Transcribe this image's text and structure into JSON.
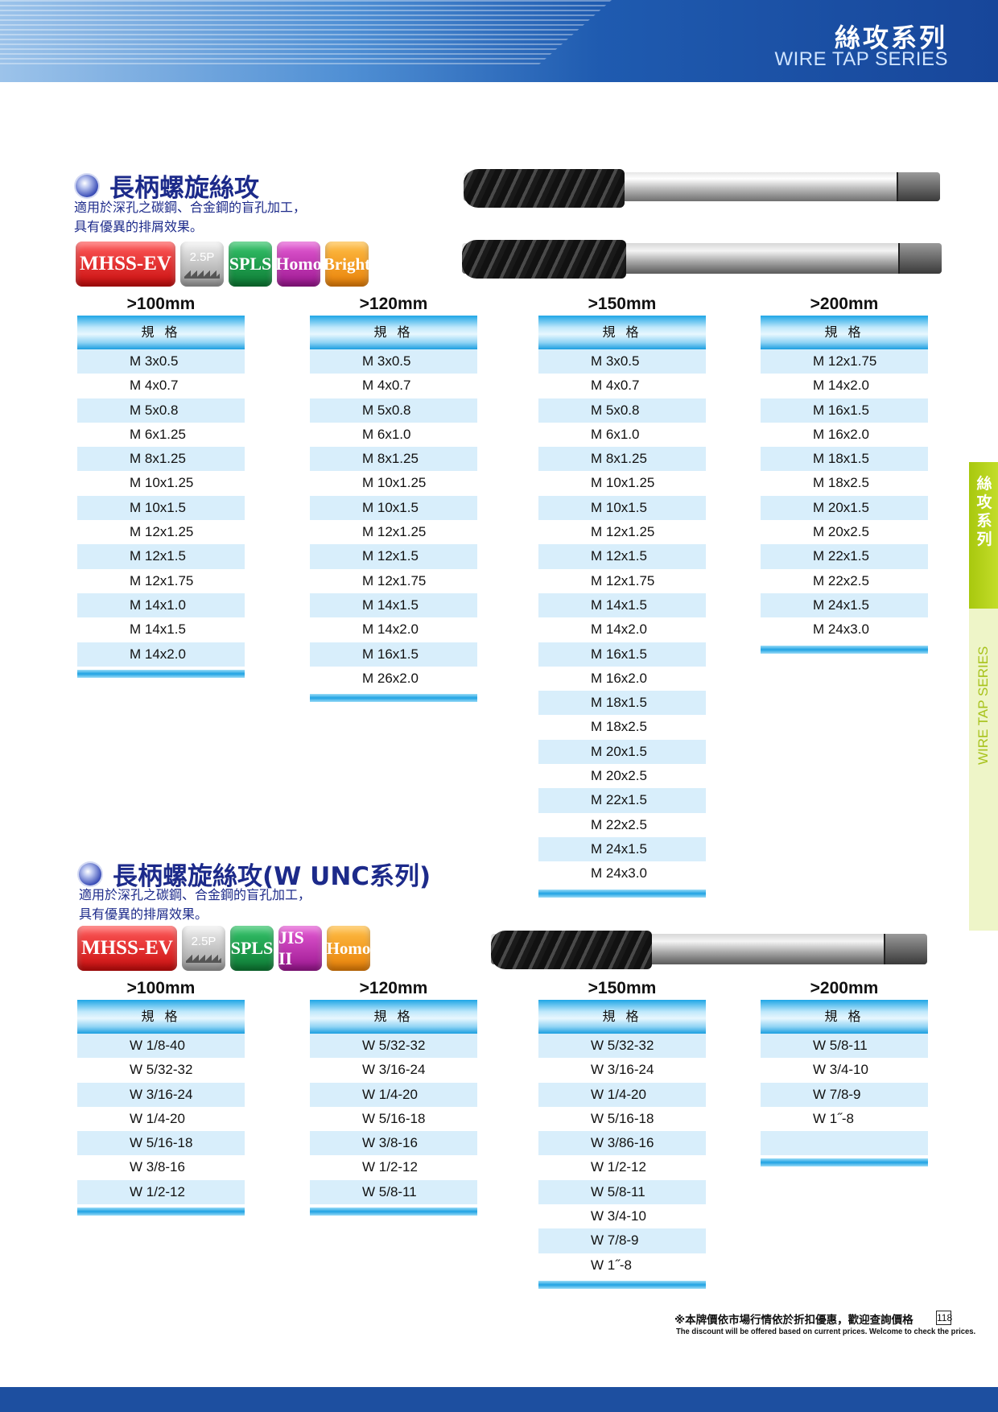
{
  "header": {
    "title_zh": "絲攻系列",
    "title_en": "WIRE TAP SERIES"
  },
  "side_tab": {
    "zh": "絲\n攻\n系\n列",
    "en": "WIRE TAP SERIES"
  },
  "section1": {
    "title": "長柄螺旋絲攻",
    "desc1": "適用於深孔之碳鋼、合金鋼的盲孔加工，",
    "desc2": "具有優異的排屑效果。",
    "badges": [
      "MHSS-EV",
      "2.5P",
      "SPLS",
      "Homo",
      "Bright"
    ],
    "columns": [
      {
        "head": ">100mm",
        "th": "規 格",
        "rows": [
          "M 3x0.5",
          "M 4x0.7",
          "M 5x0.8",
          "M 6x1.25",
          "M 8x1.25",
          "M 10x1.25",
          "M 10x1.5",
          "M 12x1.25",
          "M 12x1.5",
          "M 12x1.75",
          "M 14x1.0",
          "M 14x1.5",
          "M 14x2.0"
        ]
      },
      {
        "head": ">120mm",
        "th": "規 格",
        "rows": [
          "M 3x0.5",
          "M 4x0.7",
          "M 5x0.8",
          "M 6x1.0",
          "M 8x1.25",
          "M 10x1.25",
          "M 10x1.5",
          "M 12x1.25",
          "M 12x1.5",
          "M 12x1.75",
          "M 14x1.5",
          "M 14x2.0",
          "M 16x1.5",
          "M 26x2.0"
        ]
      },
      {
        "head": ">150mm",
        "th": "規 格",
        "rows": [
          "M 3x0.5",
          "M 4x0.7",
          "M 5x0.8",
          "M 6x1.0",
          "M 8x1.25",
          "M 10x1.25",
          "M 10x1.5",
          "M 12x1.25",
          "M 12x1.5",
          "M 12x1.75",
          "M 14x1.5",
          "M 14x2.0",
          "M 16x1.5",
          "M 16x2.0",
          "M 18x1.5",
          "M 18x2.5",
          "M 20x1.5",
          "M 20x2.5",
          "M 22x1.5",
          "M 22x2.5",
          "M 24x1.5",
          "M 24x3.0"
        ]
      },
      {
        "head": ">200mm",
        "th": "規 格",
        "rows": [
          "M 12x1.75",
          "M 14x2.0",
          "M 16x1.5",
          "M 16x2.0",
          "M 18x1.5",
          "M 18x2.5",
          "M 20x1.5",
          "M 20x2.5",
          "M 22x1.5",
          "M 22x2.5",
          "M 24x1.5",
          "M 24x3.0"
        ]
      }
    ]
  },
  "section2": {
    "title": "長柄螺旋絲攻(W UNC系列)",
    "desc1": "適用於深孔之碳鋼、合金鋼的盲孔加工，",
    "desc2": "具有優異的排屑效果。",
    "badges": [
      "MHSS-EV",
      "2.5P",
      "SPLS",
      "JIS II",
      "Homo"
    ],
    "columns": [
      {
        "head": ">100mm",
        "th": "規 格",
        "rows": [
          "W 1/8-40",
          "W 5/32-32",
          "W 3/16-24",
          "W 1/4-20",
          "W 5/16-18",
          "W 3/8-16",
          "W 1/2-12"
        ]
      },
      {
        "head": ">120mm",
        "th": "規 格",
        "rows": [
          "W 5/32-32",
          "W 3/16-24",
          "W 1/4-20",
          "W 5/16-18",
          "W 3/8-16",
          "W 1/2-12",
          "W 5/8-11"
        ]
      },
      {
        "head": ">150mm",
        "th": "規 格",
        "rows": [
          "W 5/32-32",
          "W 3/16-24",
          "W 1/4-20",
          "W 5/16-18",
          "W 3/86-16",
          "W 1/2-12",
          "W 5/8-11",
          "W 3/4-10",
          "W 7/8-9",
          "W 1˝-8"
        ]
      },
      {
        "head": ">200mm",
        "th": "規 格",
        "rows": [
          "W 5/8-11",
          "W 3/4-10",
          "W 7/8-9",
          "W 1˝-8",
          ""
        ]
      }
    ]
  },
  "footer": {
    "note_zh": "※本牌價依市場行情依於折扣優惠，歡迎查詢價格",
    "page": "118",
    "note_en": "The discount will be offered based on current prices. Welcome to check the prices."
  }
}
